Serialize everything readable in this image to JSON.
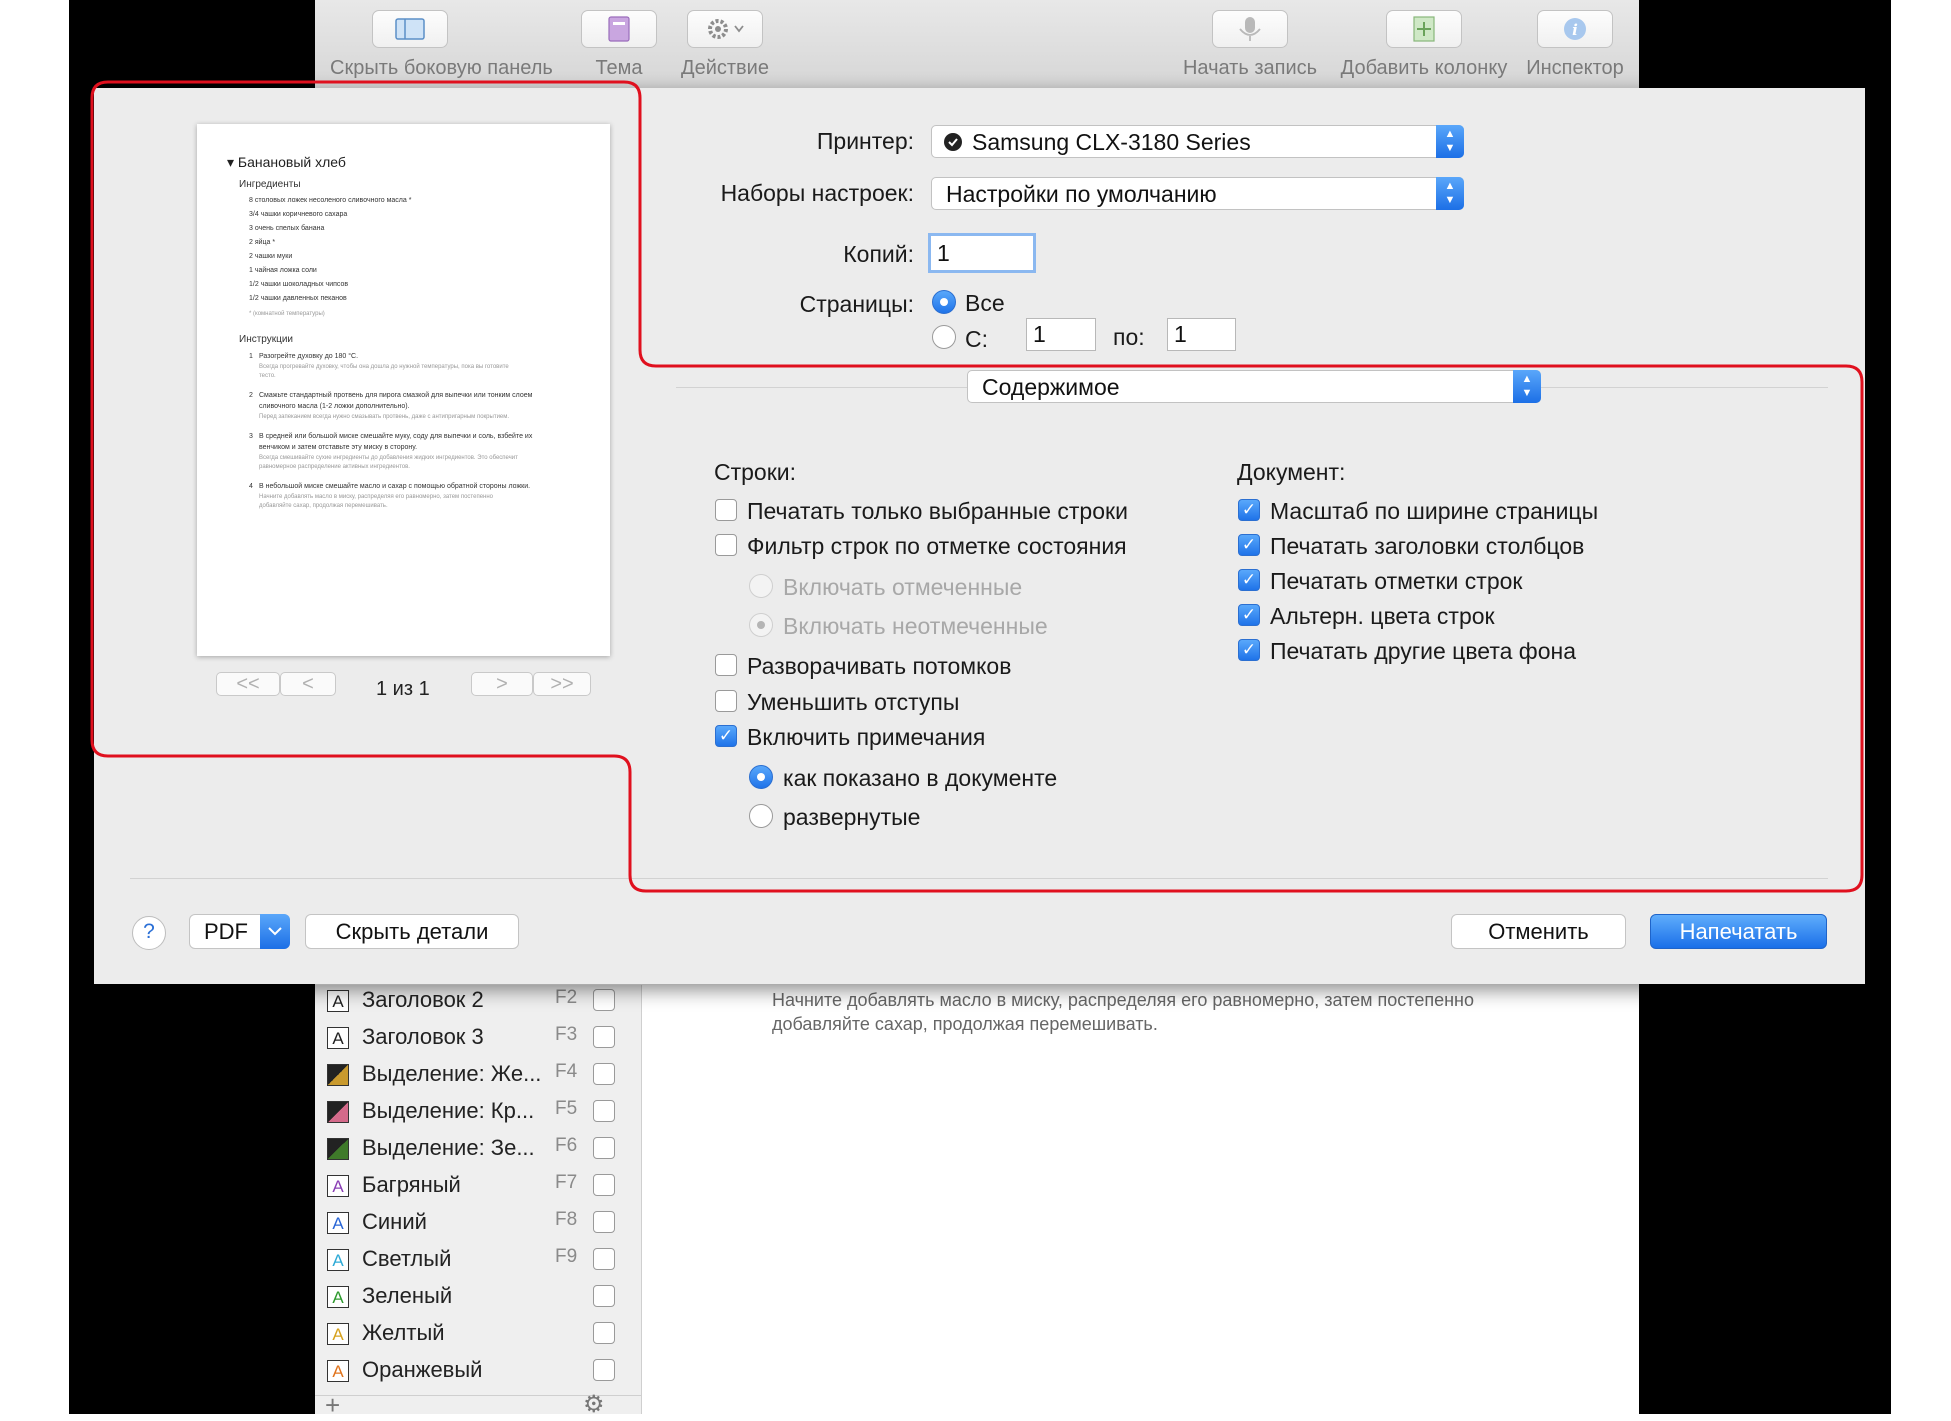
{
  "toolbar": {
    "buttons": [
      {
        "label": "Скрыть боковую панель",
        "icon": "sidebar-icon"
      },
      {
        "label": "Тема",
        "icon": "theme-icon"
      },
      {
        "label": "Действие",
        "icon": "gear-icon"
      },
      {
        "label": "Начать запись",
        "icon": "microphone-icon"
      },
      {
        "label": "Добавить колонку",
        "icon": "add-column-icon"
      },
      {
        "label": "Инспектор",
        "icon": "info-icon"
      }
    ]
  },
  "preview": {
    "title": "▾ Банановый хлеб",
    "ingredients_heading": "Ингредиенты",
    "ingredients": [
      "8 столовых ложек несоленого сливочного масла *",
      "3/4 чашки коричневого сахара",
      "3 очень спелых банана",
      "2 яйца *",
      "2 чашки муки",
      "1 чайная ложка соли",
      "1/2 чашки шоколадных чипсов",
      "1/2 чашки давленных пеканов"
    ],
    "footnote": "* (комнатной температуры)",
    "instructions_heading": "Инструкции",
    "steps": [
      {
        "num": "1",
        "main": "Разогрейте духовку до 180 °C.",
        "notes": [
          "Всегда прогревайте духовку, чтобы она дошла до нужной температуры, пока вы готовите",
          "тесто."
        ]
      },
      {
        "num": "2",
        "main": "Смажьте стандартный протвень для пирога смазкой для выпечки или тонким слоем",
        "cont": "сливочного масла (1-2 ложки дополнительно).",
        "notes": [
          "Перед запеканием всегда нужно смазывать протвень, даже с антипригарным покрытием."
        ]
      },
      {
        "num": "3",
        "main": "В средней или большой миске смешайте муку, соду для выпечки и соль, взбейте их",
        "cont": "венчиком и затем отставьте эту миску в сторону.",
        "notes": [
          "Всегда смешивайте сухие ингредиенты до добавления жидких ингредиентов. Это обеспечит",
          "равномерное распределение активных ингредиентов."
        ]
      },
      {
        "num": "4",
        "main": "В небольшой миске смешайте масло и сахар с помощью обратной стороны ложки.",
        "notes": [
          "Начните добавлять масло в миску, распределяя его равномерно, затем постепенно",
          "добавляйте сахар, продолжая перемешивать."
        ]
      }
    ],
    "nav": {
      "first": "<<",
      "prev": "<",
      "next": ">",
      "last": ">>",
      "page_indicator": "1 из 1"
    }
  },
  "print": {
    "printer_label": "Принтер:",
    "printer_value": "Samsung CLX-3180 Series",
    "presets_label": "Наборы настроек:",
    "presets_value": "Настройки по умолчанию",
    "copies_label": "Копий:",
    "copies_value": "1",
    "pages_label": "Страницы:",
    "pages_all": "Все",
    "pages_from_label": "С:",
    "pages_from_value": "1",
    "pages_to_label": "по:",
    "pages_to_value": "1",
    "section_value": "Содержимое"
  },
  "rows": {
    "heading": "Строки:",
    "options": [
      {
        "label": "Печатать только выбранные строки",
        "checked": false
      },
      {
        "label": "Фильтр строк по отметке состояния",
        "checked": false
      },
      {
        "label": "Включать отмеченные",
        "radio": true,
        "disabled": true,
        "checked": false
      },
      {
        "label": "Включать неотмеченные",
        "radio": true,
        "disabled": true,
        "checked": true
      },
      {
        "label": "Разворачивать потомков",
        "checked": false
      },
      {
        "label": "Уменьшить отступы",
        "checked": false
      },
      {
        "label": "Включить примечания",
        "checked": true
      },
      {
        "label": "как показано в документе",
        "radio": true,
        "checked": true
      },
      {
        "label": "развернутые",
        "radio": true,
        "checked": false
      }
    ]
  },
  "document": {
    "heading": "Документ:",
    "options": [
      {
        "label": "Масштаб по ширине страницы",
        "checked": true
      },
      {
        "label": "Печатать заголовки столбцов",
        "checked": true
      },
      {
        "label": "Печатать отметки строк",
        "checked": true
      },
      {
        "label": "Альтерн. цвета строк",
        "checked": true
      },
      {
        "label": "Печатать другие цвета фона",
        "checked": true
      }
    ]
  },
  "footer": {
    "help": "?",
    "pdf": "PDF",
    "hide_details": "Скрыть детали",
    "cancel": "Отменить",
    "print": "Напечатать"
  },
  "doc_text": [
    "Начните добавлять масло в миску, распределяя его равномерно, затем постепенно",
    "добавляйте сахар, продолжая перемешивать."
  ],
  "styles": [
    {
      "label": "Заголовок 2",
      "key": "F2",
      "swatch": "A",
      "color": "#222222"
    },
    {
      "label": "Заголовок 3",
      "key": "F3",
      "swatch": "A",
      "color": "#222222"
    },
    {
      "label": "Выделение: Же...",
      "key": "F4",
      "swatch": "",
      "color": "#c99a2e"
    },
    {
      "label": "Выделение: Кр...",
      "key": "F5",
      "swatch": "",
      "color": "#d46a8a"
    },
    {
      "label": "Выделение: Зе...",
      "key": "F6",
      "swatch": "",
      "color": "#3f7a2a"
    },
    {
      "label": "Багряный",
      "key": "F7",
      "swatch": "A",
      "color": "#8a3fb5"
    },
    {
      "label": "Синий",
      "key": "F8",
      "swatch": "A",
      "color": "#2a66d6"
    },
    {
      "label": "Светлый",
      "key": "F9",
      "swatch": "A",
      "color": "#2eaad6"
    },
    {
      "label": "Зеленый",
      "key": "",
      "swatch": "A",
      "color": "#2e9a2e"
    },
    {
      "label": "Желтый",
      "key": "",
      "swatch": "A",
      "color": "#d6a21e"
    },
    {
      "label": "Оранжевый",
      "key": "",
      "swatch": "A",
      "color": "#e0741e"
    }
  ],
  "sidebar_footer": {
    "add": "+",
    "gear": "⚙",
    "chevron": "⌄"
  },
  "colors": {
    "highlight": "#e0101e",
    "accent": "#1f73e9"
  }
}
